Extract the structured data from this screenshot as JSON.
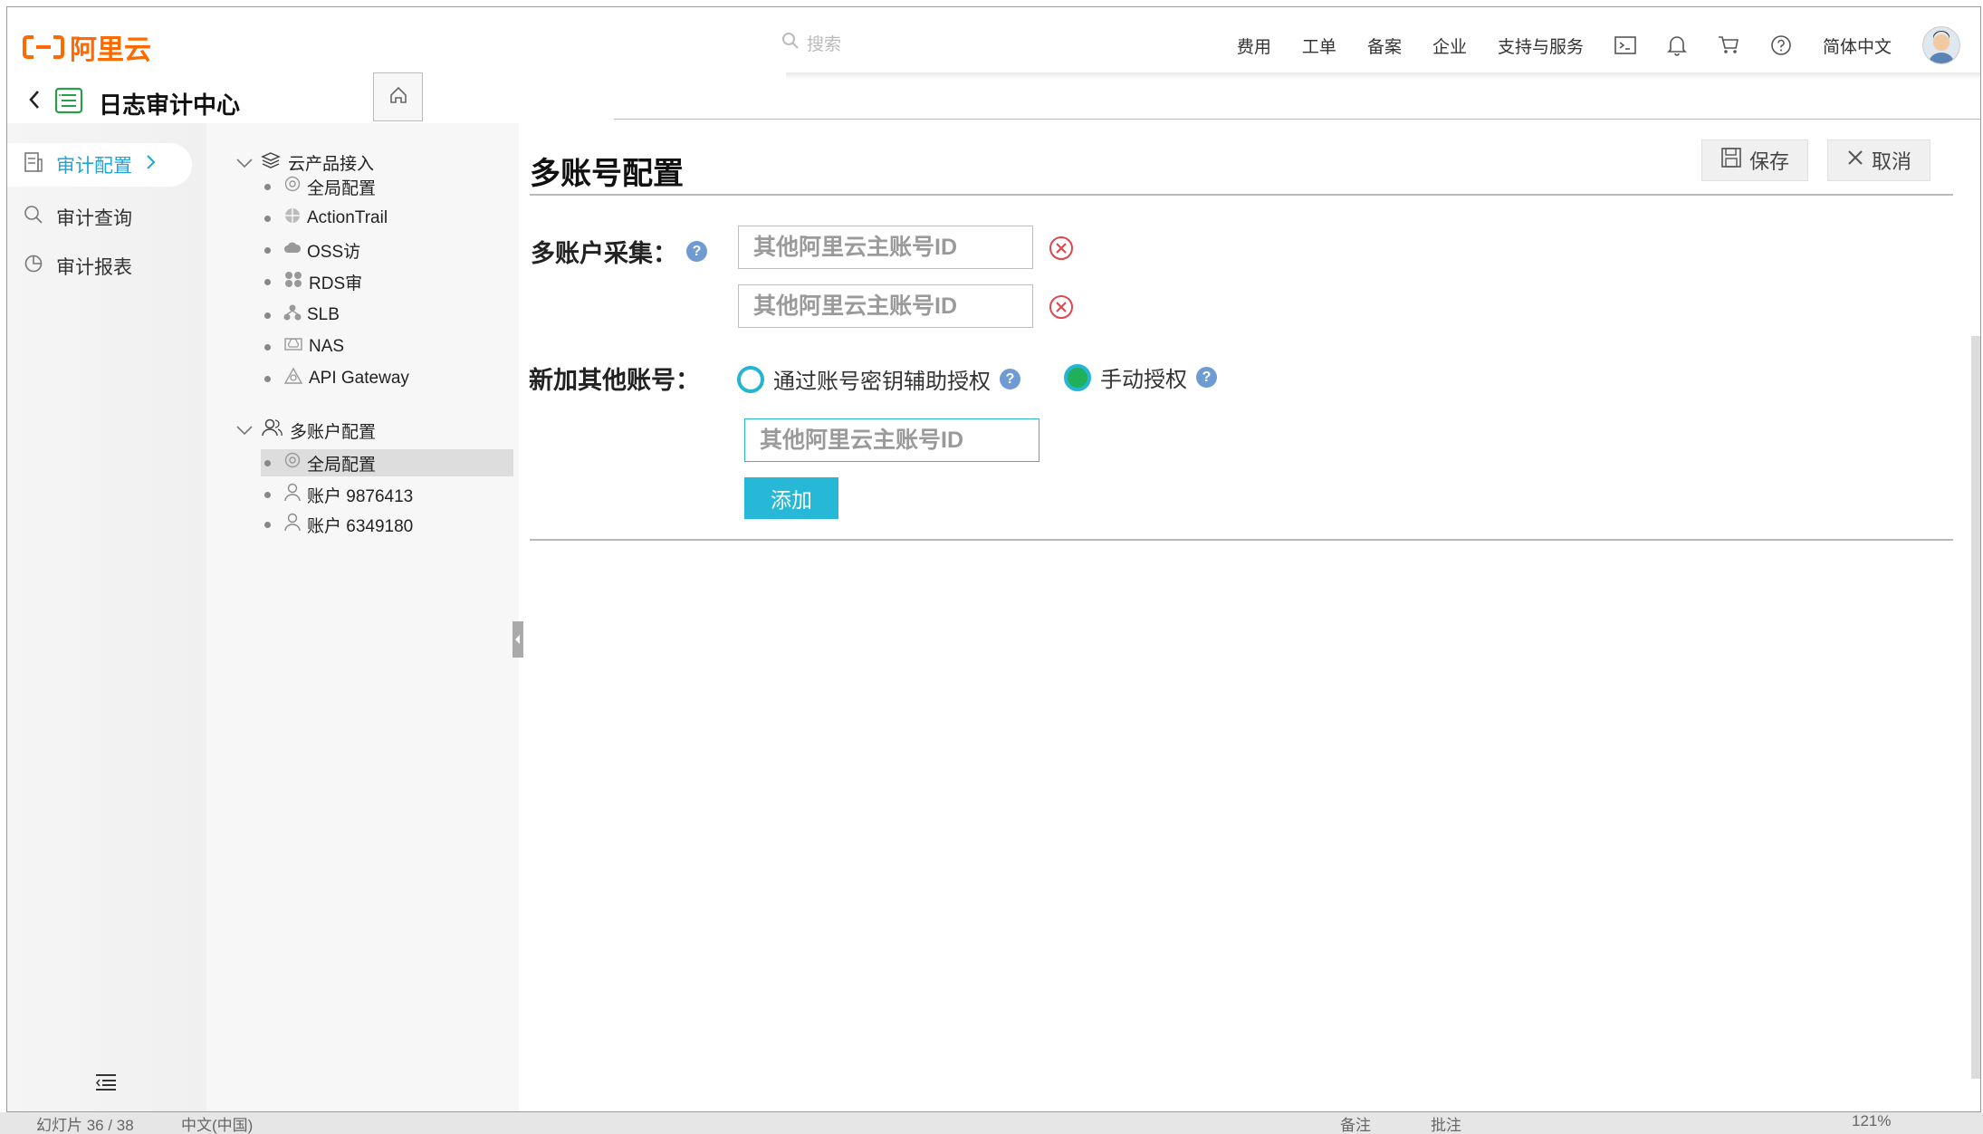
{
  "topbar": {
    "logo_text": "阿里云",
    "search_placeholder": "搜索",
    "nav": [
      "费用",
      "工单",
      "备案",
      "企业",
      "支持与服务"
    ],
    "language": "简体中文",
    "icons": [
      "terminal-icon",
      "bell-icon",
      "cart-icon",
      "help-circle-icon"
    ]
  },
  "app": {
    "title": "日志审计中心"
  },
  "sidenav": {
    "items": [
      {
        "label": "审计配置",
        "active": true
      },
      {
        "label": "审计查询",
        "active": false
      },
      {
        "label": "审计报表",
        "active": false
      }
    ]
  },
  "tree": {
    "group1": {
      "label": "云产品接入",
      "children": [
        "全局配置",
        "ActionTrail",
        "OSS访",
        "RDS审",
        "SLB",
        "NAS",
        "API Gateway"
      ]
    },
    "group2": {
      "label": "多账户配置",
      "children": [
        "全局配置",
        "账户 9876413",
        "账户 6349180"
      ],
      "selected": "全局配置"
    }
  },
  "main": {
    "title": "多账号配置",
    "save_label": "保存",
    "cancel_label": "取消",
    "collect_label": "多账户采集：",
    "collect_inputs": [
      {
        "placeholder": "其他阿里云主账号ID"
      },
      {
        "placeholder": "其他阿里云主账号ID"
      }
    ],
    "new_label": "新加其他账号：",
    "radio_options": [
      {
        "label": "通过账号密钥辅助授权",
        "selected": false
      },
      {
        "label": "手动授权",
        "selected": true
      }
    ],
    "new_input_placeholder": "其他阿里云主账号ID",
    "add_label": "添加"
  },
  "statusbar": {
    "slide": "幻灯片 36 / 38",
    "lang": "中文(中国)",
    "notes": "备注",
    "comments": "批注",
    "zoom": "121%"
  },
  "colors": {
    "brand": "#ff6a00",
    "accent": "#27b8d8",
    "active_nav": "#1fa5d7",
    "remove": "#e0464b",
    "radio_checked": "#21b05a"
  }
}
